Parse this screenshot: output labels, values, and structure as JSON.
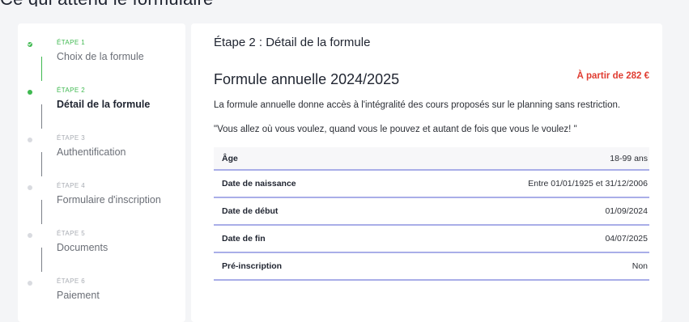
{
  "top_text": "Ce qui attend le formulaire",
  "steps": [
    {
      "num": "ÉTAPE 1",
      "label": "Choix de la formule",
      "state": "done"
    },
    {
      "num": "ÉTAPE 2",
      "label": "Détail de la formule",
      "state": "active"
    },
    {
      "num": "ÉTAPE 3",
      "label": "Authentification",
      "state": "pending"
    },
    {
      "num": "ÉTAPE 4",
      "label": "Formulaire d'inscription",
      "state": "pending"
    },
    {
      "num": "ÉTAPE 5",
      "label": "Documents",
      "state": "pending"
    },
    {
      "num": "ÉTAPE 6",
      "label": "Paiement",
      "state": "pending"
    }
  ],
  "main": {
    "step_title": "Étape 2 : Détail de la formule",
    "formula_title": "Formule annuelle 2024/2025",
    "price": "À partir de 282 €",
    "description1": "La formule annuelle donne accès à l'intégralité des cours proposés sur le planning sans restriction.",
    "description2": "\"Vous allez où vous voulez, quand vous le pouvez et autant de fois que vous le voulez! \"",
    "details": [
      {
        "key": "Âge",
        "value": "18-99 ans"
      },
      {
        "key": "Date de naissance",
        "value": "Entre 01/01/1925 et 31/12/2006"
      },
      {
        "key": "Date de début",
        "value": "01/09/2024"
      },
      {
        "key": "Date de fin",
        "value": "04/07/2025"
      },
      {
        "key": "Pré-inscription",
        "value": "Non"
      }
    ]
  },
  "colors": {
    "accent_green": "#3fb950",
    "price_red": "#e03c31",
    "row_border": "#a9aee8"
  }
}
